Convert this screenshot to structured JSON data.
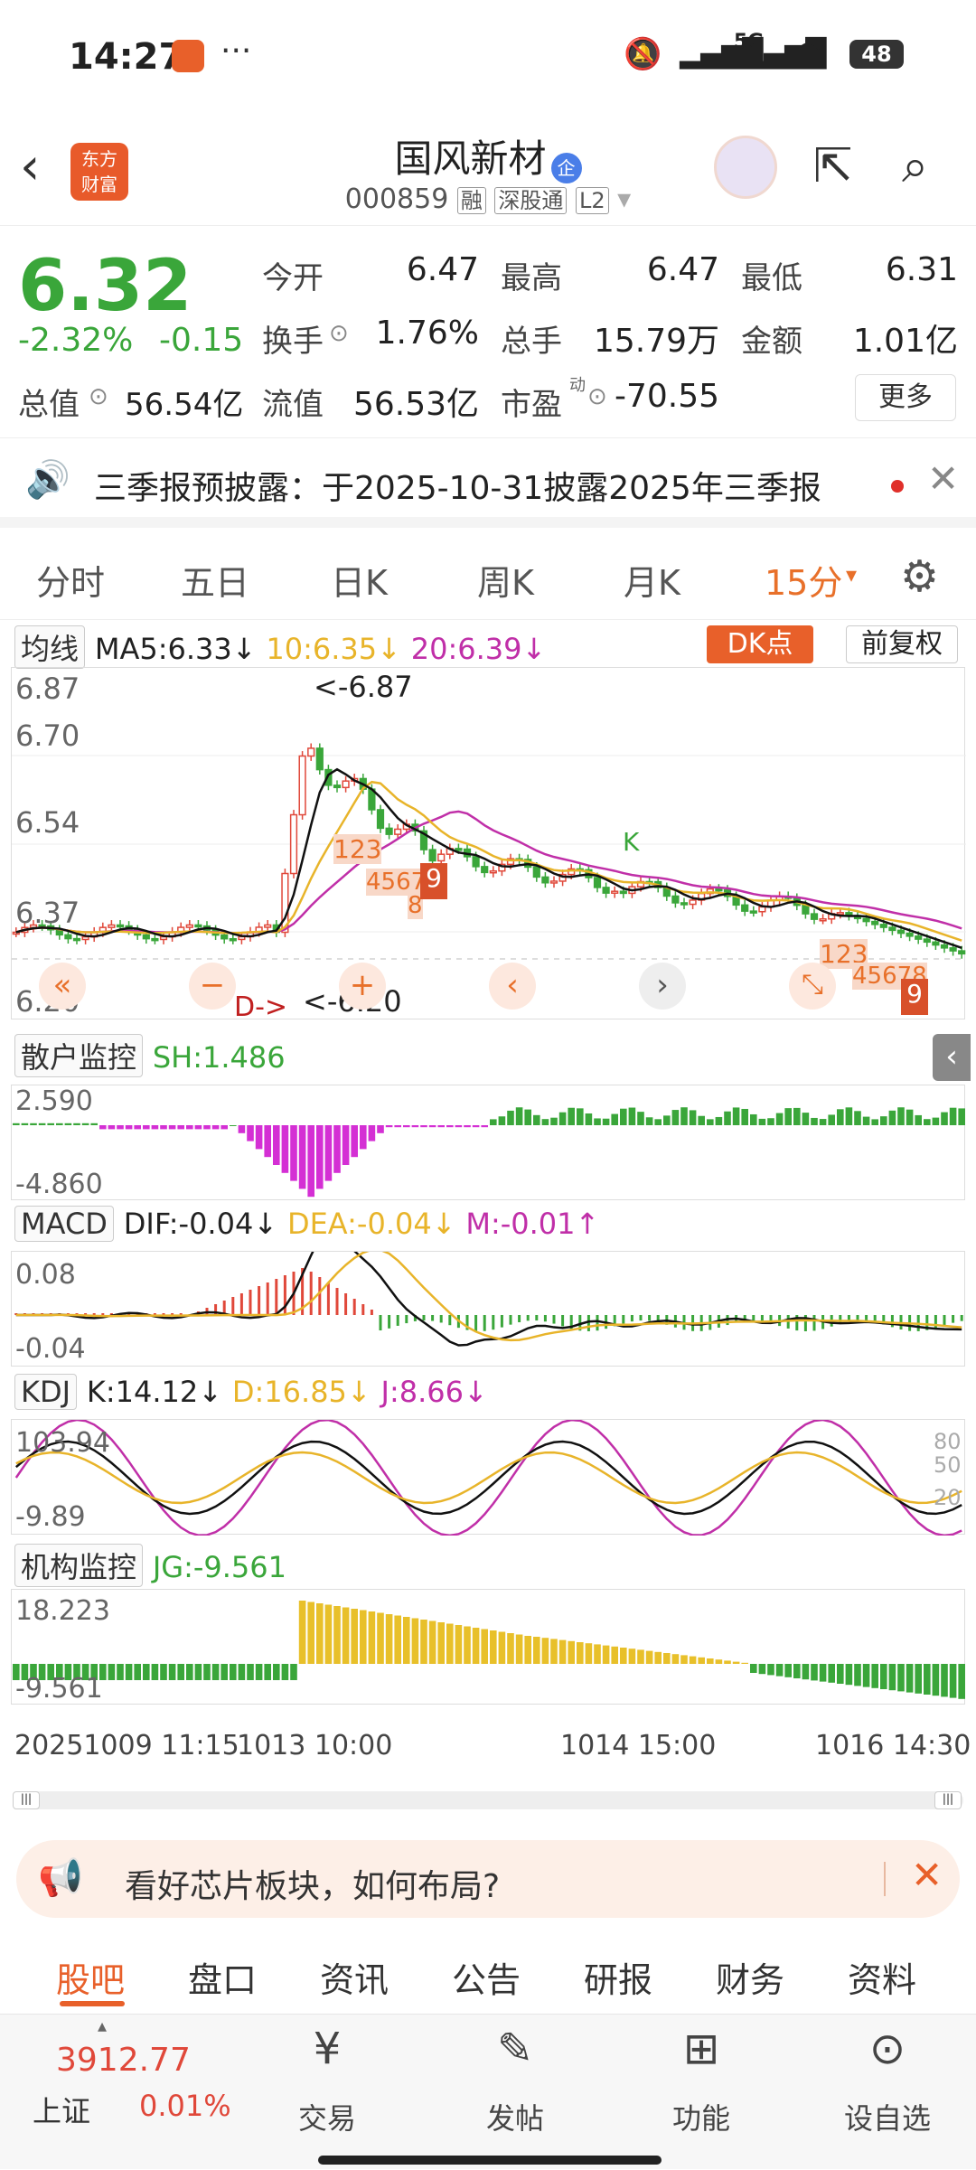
{
  "status": {
    "time": "14:27",
    "signal": "5G",
    "battery": "48"
  },
  "header": {
    "logo_line1": "东方",
    "logo_line2": "财富",
    "title": "国风新材",
    "badge": "企",
    "code": "000859",
    "tag1": "融",
    "tag2": "深股通",
    "tag3": "L2"
  },
  "quote": {
    "price": "6.32",
    "change_pct": "-2.32%",
    "change": "-0.15",
    "open_label": "今开",
    "open": "6.47",
    "high_label": "最高",
    "high": "6.47",
    "low_label": "最低",
    "low": "6.31",
    "turnover_label": "换手",
    "turnover": "1.76%",
    "volume_label": "总手",
    "volume": "15.79万",
    "amount_label": "金额",
    "amount": "1.01亿",
    "mktcap_label": "总值",
    "mktcap": "56.54亿",
    "float_label": "流值",
    "float": "56.53亿",
    "pe_label": "市盈",
    "pe_sup": "动",
    "pe": "-70.55",
    "more": "更多"
  },
  "notice": {
    "text": "三季报预披露：于2025-10-31披露2025年三季报"
  },
  "tabs": [
    "分时",
    "五日",
    "日K",
    "周K",
    "月K",
    "15分"
  ],
  "ma": {
    "sel": "均线",
    "ma5": "MA5:6.33↓",
    "ma10": "10:6.35↓",
    "ma20": "20:6.39↓",
    "dk": "DK点",
    "adj": "前复权"
  },
  "kline": {
    "y1": "6.87",
    "y2": "6.70",
    "y3": "6.54",
    "y4": "6.37",
    "y5": "6.20",
    "hi_label": "<-6.87",
    "lo_label": "<-6.20",
    "d_label": "D->",
    "marker_a": "123",
    "marker_b": "4567",
    "marker_c": "8",
    "marker_d": "9",
    "marker_e": "123",
    "marker_f": "45678",
    "marker_g": "9",
    "k_label": "K"
  },
  "retail": {
    "sel": "散户监控",
    "sh": "SH:1.486",
    "y1": "2.590",
    "y2": "-4.860"
  },
  "macd": {
    "sel": "MACD",
    "dif": "DIF:-0.04↓",
    "dea": "DEA:-0.04↓",
    "m": "M:-0.01↑",
    "y1": "0.08",
    "y2": "-0.04"
  },
  "kdj": {
    "sel": "KDJ",
    "k": "K:14.12↓",
    "d": "D:16.85↓",
    "j": "J:8.66↓",
    "y1": "103.94",
    "y2": "-9.89",
    "r80": "80",
    "r50": "50",
    "r20": "20"
  },
  "inst": {
    "sel": "机构监控",
    "jg": "JG:-9.561",
    "y1": "18.223",
    "y2": "-9.561"
  },
  "xaxis": [
    "20251009 11:15",
    "1013 10:00",
    "1014 15:00",
    "1016 14:30"
  ],
  "ad": {
    "text": "看好芯片板块，如何布局?"
  },
  "bottom_tabs": [
    "股吧",
    "盘口",
    "资讯",
    "公告",
    "研报",
    "财务",
    "资料"
  ],
  "nav": {
    "index_value": "3912.77",
    "index_name": "上证",
    "index_pct": "0.01%",
    "trade": "交易",
    "post": "发帖",
    "func": "功能",
    "fav": "设自选"
  },
  "colors": {
    "up": "#e0483a",
    "down": "#3aa63a",
    "accent": "#e8702a",
    "ma10": "#e8b42a",
    "ma20": "#c02fa8"
  }
}
